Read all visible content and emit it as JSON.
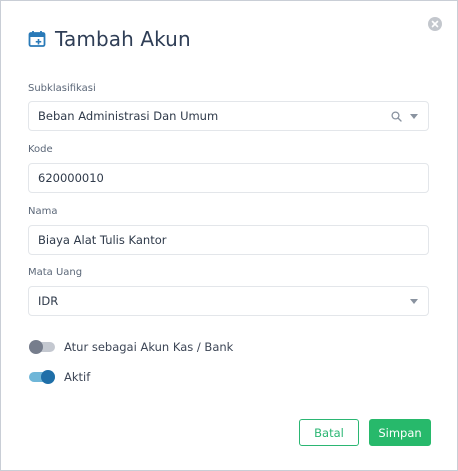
{
  "dialog": {
    "title": "Tambah Akun",
    "close_icon": "close-icon",
    "title_icon": "calendar-add-icon"
  },
  "fields": {
    "subklasifikasi": {
      "label": "Subklasifikasi",
      "value": "Beban Administrasi Dan Umum",
      "icons": [
        "search-icon",
        "chevron-down-icon"
      ]
    },
    "kode": {
      "label": "Kode",
      "value": "620000010"
    },
    "nama": {
      "label": "Nama",
      "value": "Biaya Alat Tulis Kantor"
    },
    "mata_uang": {
      "label": "Mata Uang",
      "value": "IDR",
      "icons": [
        "chevron-down-icon"
      ]
    }
  },
  "toggles": {
    "kas_bank": {
      "label": "Atur sebagai Akun Kas / Bank",
      "on": false
    },
    "aktif": {
      "label": "Aktif",
      "on": true
    }
  },
  "buttons": {
    "cancel_label": "Batal",
    "save_label": "Simpan"
  },
  "colors": {
    "primary_green": "#27b96b",
    "toggle_on": "#1f6fa8",
    "title": "#2f3e56"
  }
}
